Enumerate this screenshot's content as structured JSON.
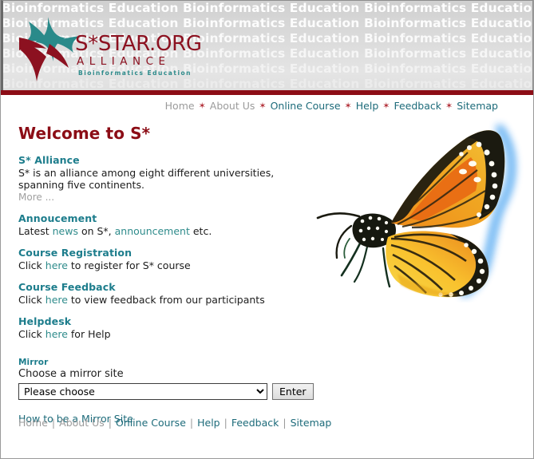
{
  "banner": {
    "repeat_text": "Bioinformatics Education",
    "rows": 7,
    "logo": {
      "main": "S*STAR.ORG",
      "sub": "ALLIANCE",
      "tagline": "Bioinformatics Education",
      "star_teal": "#2e8b8b",
      "star_red": "#8c1120"
    }
  },
  "colors": {
    "brand_red": "#8c0d16",
    "brand_teal": "#1d7d8c",
    "link_teal": "#2e8b8b",
    "nav_teal": "#1d6b7a",
    "muted_gray": "#9b9b9b",
    "bullet_red": "#b3313a"
  },
  "topnav": {
    "items": [
      {
        "label": "Home",
        "muted": true
      },
      {
        "label": "About Us",
        "muted": true
      },
      {
        "label": "Online Course",
        "muted": false
      },
      {
        "label": "Help",
        "muted": false
      },
      {
        "label": "Feedback",
        "muted": false
      },
      {
        "label": "Sitemap",
        "muted": false
      }
    ],
    "separator": "✶"
  },
  "main": {
    "heading": "Welcome to S*",
    "sections": [
      {
        "title": "S* Alliance",
        "body_pre": "S* is an alliance among eight different universities, spanning five continents.",
        "more_label": "More ..."
      },
      {
        "title": "Annoucement",
        "text_1": "Latest ",
        "link_1": "news",
        "text_2": " on S*, ",
        "link_2": "announcement",
        "text_3": " etc."
      },
      {
        "title": "Course Registration",
        "text_1": "Click ",
        "link_1": "here",
        "text_2": " to register for S* course"
      },
      {
        "title": "Course Feedback",
        "text_1": "Click ",
        "link_1": "here",
        "text_2": " to view feedback from our participants"
      },
      {
        "title": "Helpdesk",
        "text_1": "Click ",
        "link_1": "here",
        "text_2": " for Help"
      }
    ],
    "mirror": {
      "label": "Mirror",
      "sublabel": "Choose a mirror site",
      "selected_option": "Please choose",
      "options": [
        "Please choose"
      ],
      "enter_label": "Enter",
      "howto_label": "How to be a Mirror Site"
    },
    "image": {
      "name": "monarch-butterfly",
      "glow_color": "#4aa3f0"
    }
  },
  "footer": {
    "items": [
      {
        "label": "Home",
        "muted": true
      },
      {
        "label": "About Us",
        "muted": true
      },
      {
        "label": "Online Course",
        "muted": false
      },
      {
        "label": "Help",
        "muted": false
      },
      {
        "label": "Feedback",
        "muted": false
      },
      {
        "label": "Sitemap",
        "muted": false
      }
    ],
    "separator": "|"
  }
}
